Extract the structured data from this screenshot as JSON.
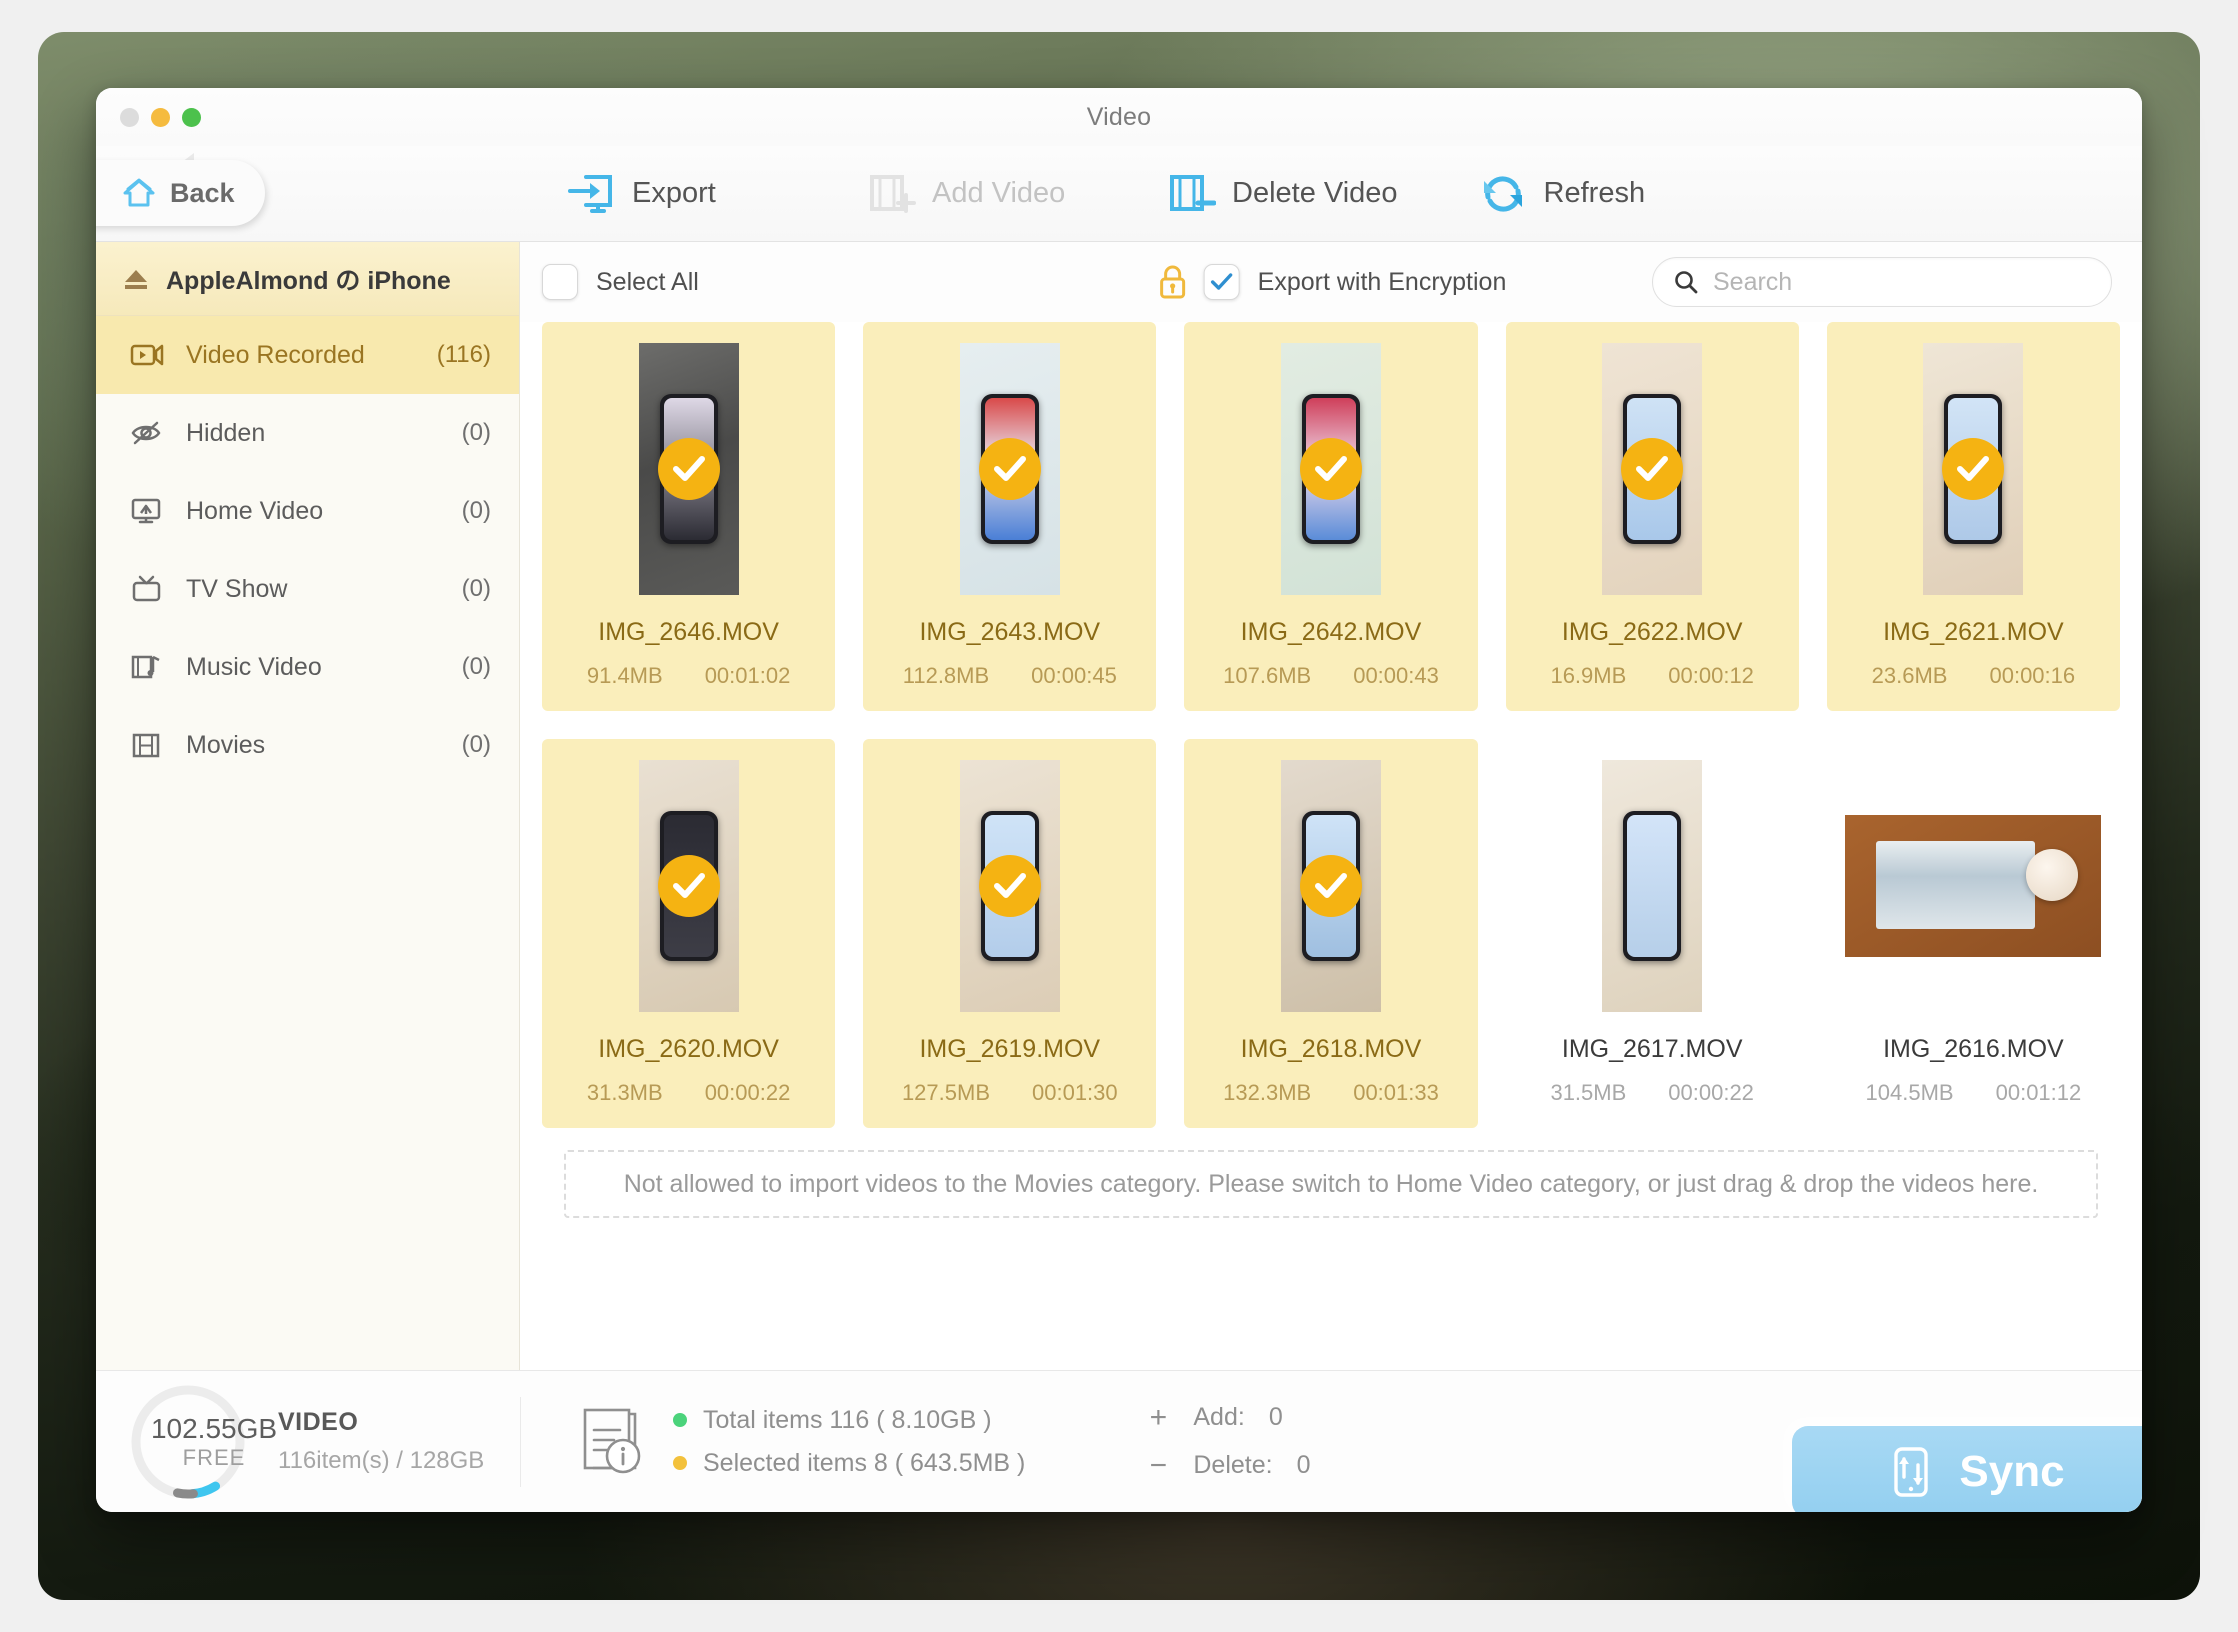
{
  "window": {
    "title": "Video",
    "traffic_lights": [
      "close",
      "minimize",
      "maximize"
    ]
  },
  "toolbar": {
    "back_label": "Back",
    "items": [
      {
        "label": "Export",
        "icon": "export-icon",
        "enabled": true
      },
      {
        "label": "Add Video",
        "icon": "add-video-icon",
        "enabled": false
      },
      {
        "label": "Delete Video",
        "icon": "delete-video-icon",
        "enabled": true
      },
      {
        "label": "Refresh",
        "icon": "refresh-icon",
        "enabled": true
      }
    ]
  },
  "sidebar": {
    "device_name": "AppleAlmond の iPhone",
    "items": [
      {
        "label": "Video Recorded",
        "count": "(116)",
        "icon": "video-camera-icon",
        "active": true
      },
      {
        "label": "Hidden",
        "count": "(0)",
        "icon": "eye-off-icon",
        "active": false
      },
      {
        "label": "Home Video",
        "count": "(0)",
        "icon": "home-video-icon",
        "active": false
      },
      {
        "label": "TV Show",
        "count": "(0)",
        "icon": "tv-icon",
        "active": false
      },
      {
        "label": "Music Video",
        "count": "(0)",
        "icon": "music-video-icon",
        "active": false
      },
      {
        "label": "Movies",
        "count": "(0)",
        "icon": "film-icon",
        "active": false
      }
    ]
  },
  "content_header": {
    "select_all_label": "Select All",
    "select_all_checked": false,
    "encryption_label": "Export with Encryption",
    "encryption_checked": true,
    "lock_icon": "lock-icon",
    "search_placeholder": "Search",
    "search_value": ""
  },
  "videos": [
    {
      "name": "IMG_2646.MOV",
      "size": "91.4MB",
      "duration": "00:01:02",
      "selected": true,
      "orientation": "portrait",
      "thumb": "hand-tapping-phone-on-concrete"
    },
    {
      "name": "IMG_2643.MOV",
      "size": "112.8MB",
      "duration": "00:00:45",
      "selected": true,
      "orientation": "portrait",
      "thumb": "phone-on-light-grid-surface"
    },
    {
      "name": "IMG_2642.MOV",
      "size": "107.6MB",
      "duration": "00:00:43",
      "selected": true,
      "orientation": "portrait",
      "thumb": "phone-on-mint-fabric"
    },
    {
      "name": "IMG_2622.MOV",
      "size": "16.9MB",
      "duration": "00:00:12",
      "selected": true,
      "orientation": "portrait",
      "thumb": "two-hands-holding-phone"
    },
    {
      "name": "IMG_2621.MOV",
      "size": "23.6MB",
      "duration": "00:00:16",
      "selected": true,
      "orientation": "portrait",
      "thumb": "hand-holding-phone-tap"
    },
    {
      "name": "IMG_2620.MOV",
      "size": "31.3MB",
      "duration": "00:00:22",
      "selected": true,
      "orientation": "portrait",
      "thumb": "hand-holding-dark-phone"
    },
    {
      "name": "IMG_2619.MOV",
      "size": "127.5MB",
      "duration": "00:01:30",
      "selected": true,
      "orientation": "portrait",
      "thumb": "hands-using-phone-blue-screen"
    },
    {
      "name": "IMG_2618.MOV",
      "size": "132.3MB",
      "duration": "00:01:33",
      "selected": true,
      "orientation": "portrait",
      "thumb": "hands-typing-on-phone"
    },
    {
      "name": "IMG_2617.MOV",
      "size": "31.5MB",
      "duration": "00:00:22",
      "selected": false,
      "orientation": "portrait",
      "thumb": "hand-typing-emoji-keyboard"
    },
    {
      "name": "IMG_2616.MOV",
      "size": "104.5MB",
      "duration": "00:01:12",
      "selected": false,
      "orientation": "landscape",
      "thumb": "robot-vacuum-on-mat"
    }
  ],
  "drop_hint": "Not allowed to  import videos to the Movies category. Please switch to Home Video category, or just drag & drop the videos here.",
  "status": {
    "storage_free_value": "102.55GB",
    "storage_free_label": "FREE",
    "storage_kind": "VIDEO",
    "storage_items": "116item(s) / 128GB",
    "total_items": "Total items 116 ( 8.10GB )",
    "selected_items": "Selected items 8 ( 643.5MB )",
    "add_label": "Add:",
    "add_value": "0",
    "delete_label": "Delete:",
    "delete_value": "0",
    "add_symbol": "+",
    "delete_symbol": "−",
    "sync_label": "Sync"
  },
  "colors": {
    "accent_blue": "#4db8e8",
    "selected_yellow": "#faeebb",
    "badge_orange": "#f5b312",
    "sidebar_active": "#f8e9ae",
    "sync_blue": "#93cff0",
    "total_dot": "#4bd37b",
    "selected_dot": "#f3c13c"
  }
}
